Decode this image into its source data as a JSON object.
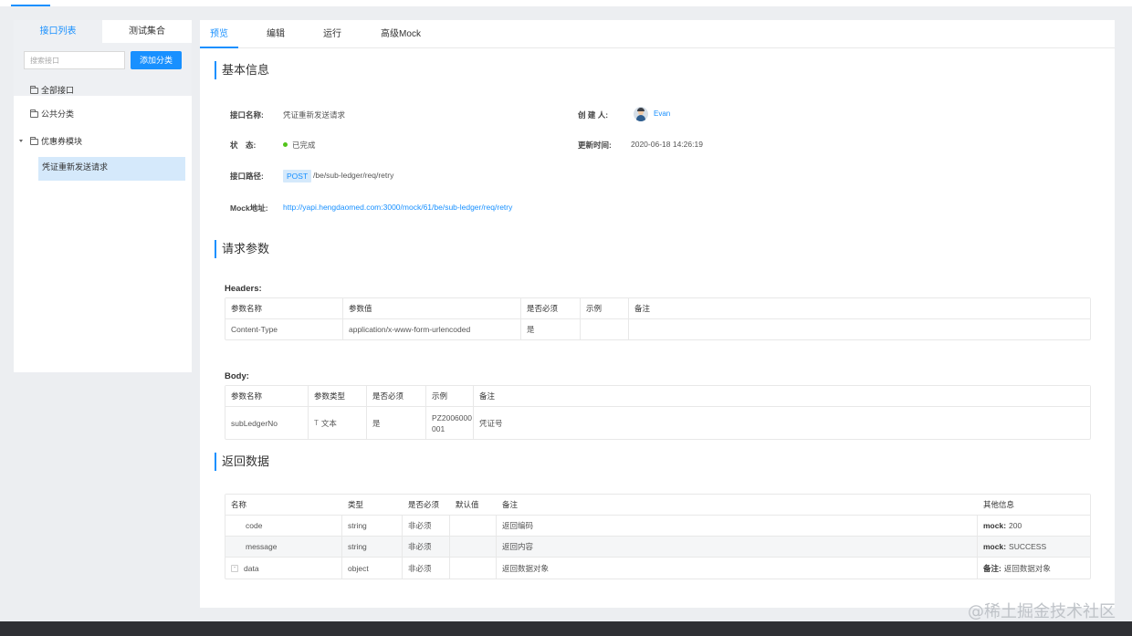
{
  "sidebar": {
    "tabs": [
      "接口列表",
      "测试集合"
    ],
    "search_placeholder": "搜索接口",
    "add_button": "添加分类",
    "tree": {
      "all": "全部接口",
      "public": "公共分类",
      "coupon": "优惠券模块",
      "selected": "凭证重新发送请求"
    }
  },
  "main": {
    "tabs": [
      "预览",
      "编辑",
      "运行",
      "高级Mock"
    ],
    "basic": {
      "title": "基本信息",
      "name_label": "接口名称:",
      "name_value": "凭证重新发送请求",
      "creator_label": "创 建 人:",
      "creator_value": "Evan",
      "status_label": "状　态:",
      "status_value": "已完成",
      "updated_label": "更新时间:",
      "updated_value": "2020-06-18 14:26:19",
      "path_label": "接口路径:",
      "method": "POST",
      "path_value": "/be/sub-ledger/req/retry",
      "mock_label": "Mock地址:",
      "mock_value": "http://yapi.hengdaomed.com:3000/mock/61/be/sub-ledger/req/retry"
    },
    "request": {
      "title": "请求参数",
      "headers_title": "Headers:",
      "headers_columns": [
        "参数名称",
        "参数值",
        "是否必须",
        "示例",
        "备注"
      ],
      "headers_rows": [
        [
          "Content-Type",
          "application/x-www-form-urlencoded",
          "是",
          "",
          ""
        ]
      ],
      "body_title": "Body:",
      "body_columns": [
        "参数名称",
        "参数类型",
        "是否必须",
        "示例",
        "备注"
      ],
      "body_rows": [
        [
          "subLedgerNo",
          "文本",
          "是",
          "PZ2006000 001",
          "凭证号"
        ]
      ]
    },
    "response": {
      "title": "返回数据",
      "columns": [
        "名称",
        "类型",
        "是否必须",
        "默认值",
        "备注",
        "其他信息"
      ],
      "rows": [
        {
          "name": "code",
          "type": "string",
          "required": "非必须",
          "default": "",
          "note": "返回编码",
          "other_key": "mock:",
          "other_val": "200"
        },
        {
          "name": "message",
          "type": "string",
          "required": "非必须",
          "default": "",
          "note": "返回内容",
          "other_key": "mock:",
          "other_val": "SUCCESS"
        },
        {
          "name": "data",
          "type": "object",
          "required": "非必须",
          "default": "",
          "note": "返回数据对象",
          "other_key": "备注:",
          "other_val": "返回数据对象"
        }
      ]
    }
  },
  "watermark": "@稀土掘金技术社区"
}
